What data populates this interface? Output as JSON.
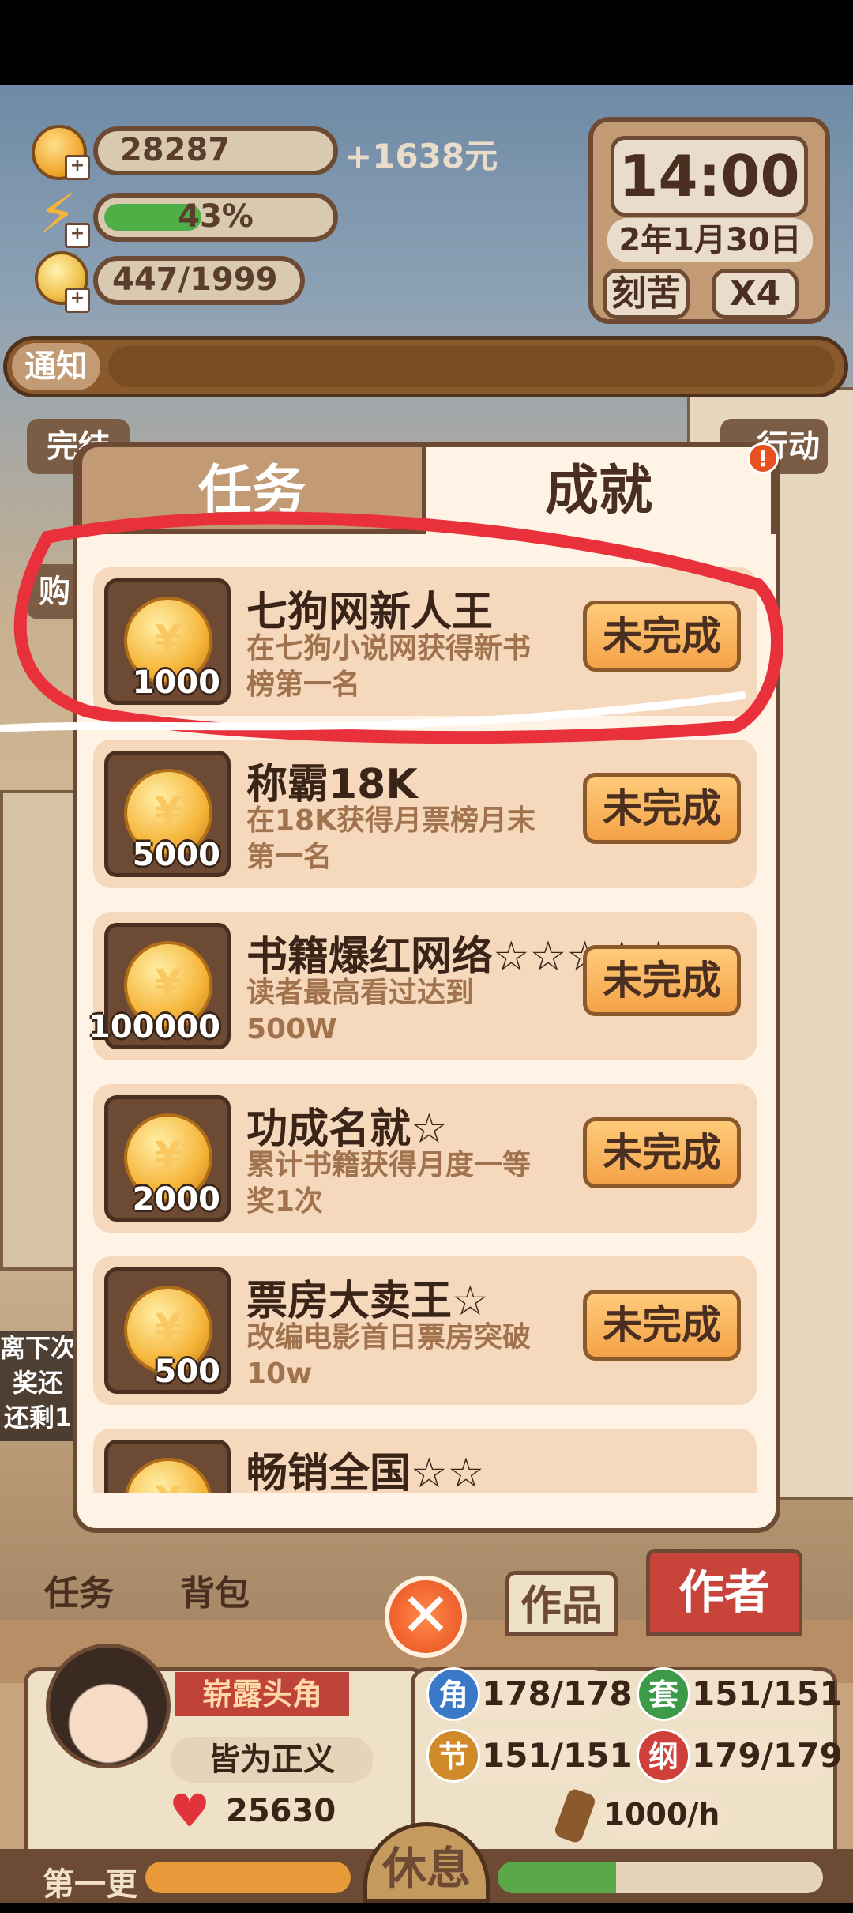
{
  "hud": {
    "coins": "28287",
    "income": "+1638元",
    "energy_percent_text": "43%",
    "energy_fraction": 0.43,
    "inspiration": "447/1999"
  },
  "clock": {
    "time": "14:00",
    "date": "2年1月30日",
    "mode": "刻苦",
    "speed": "X4"
  },
  "notice": {
    "label": "通知"
  },
  "bg_labels": {
    "left_partial": "完结",
    "right_partial": "行动",
    "left_partial2": "购"
  },
  "panel": {
    "tabs": [
      {
        "label": "任务",
        "active": false
      },
      {
        "label": "成就",
        "active": true
      }
    ],
    "badge": "!",
    "achievements": [
      {
        "reward": "1000",
        "title": "七狗网新人王",
        "desc": "在七狗小说网获得新书榜第一名",
        "button": "未完成"
      },
      {
        "reward": "5000",
        "title": "称霸18K",
        "desc": "在18K获得月票榜月末第一名",
        "button": "未完成"
      },
      {
        "reward": "100000",
        "title": "书籍爆红网络☆☆☆☆☆",
        "desc": "读者最高看过达到500W",
        "button": "未完成"
      },
      {
        "reward": "2000",
        "title": "功成名就☆",
        "desc": "累计书籍获得月度一等奖1次",
        "button": "未完成"
      },
      {
        "reward": "500",
        "title": "票房大卖王☆",
        "desc": "改编电影首日票房突破10w",
        "button": "未完成"
      },
      {
        "reward": "",
        "title": "畅销全国☆☆",
        "desc": "",
        "button": ""
      }
    ]
  },
  "left_notice": {
    "line1": "离下次",
    "line2": "奖还",
    "line3": "还剩1"
  },
  "bottom": {
    "nav": {
      "tasks": "任务",
      "bag": "背包",
      "works": "作品",
      "author": "作者"
    },
    "profile": {
      "rank": "崭露头角",
      "name": "皆为正义",
      "likes": "25630"
    },
    "stats": [
      {
        "icon": "角",
        "value": "178/178",
        "color": "#3a78c8"
      },
      {
        "icon": "套",
        "value": "151/151",
        "color": "#3c9a48"
      },
      {
        "icon": "节",
        "value": "151/151",
        "color": "#d08a2a"
      },
      {
        "icon": "纲",
        "value": "179/179",
        "color": "#d0403a"
      }
    ],
    "speed": "1000/h",
    "chapter": "第一更",
    "rest": "休息",
    "close": "✕"
  },
  "colors": {
    "accent": "#6d4a33",
    "button": "#f4a247",
    "scribble": "#e8313a"
  }
}
